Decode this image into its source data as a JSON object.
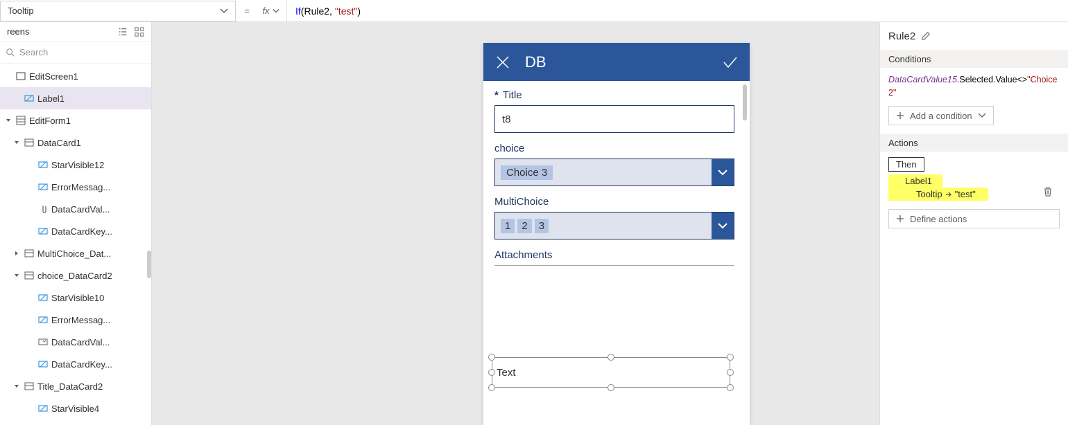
{
  "formula_bar": {
    "property": "Tooltip",
    "equals": "=",
    "fx": "fx",
    "formula_fn": "If",
    "formula_arg1": "Rule2",
    "formula_str": "\"test\""
  },
  "left_panel": {
    "header": "reens",
    "search_placeholder": "Search",
    "tree": [
      {
        "label": "EditScreen1",
        "icon": "screen",
        "indent": 0,
        "caret": ""
      },
      {
        "label": "Label1",
        "icon": "label",
        "indent": 1,
        "caret": "",
        "selected": true
      },
      {
        "label": "EditForm1",
        "icon": "form",
        "indent": 0,
        "caret": "down"
      },
      {
        "label": "DataCard1",
        "icon": "card",
        "indent": 1,
        "caret": "down"
      },
      {
        "label": "StarVisible12",
        "icon": "label",
        "indent": 2,
        "caret": ""
      },
      {
        "label": "ErrorMessag...",
        "icon": "label",
        "indent": 2,
        "caret": ""
      },
      {
        "label": "DataCardVal...",
        "icon": "attach",
        "indent": 2,
        "caret": ""
      },
      {
        "label": "DataCardKey...",
        "icon": "label",
        "indent": 2,
        "caret": ""
      },
      {
        "label": "MultiChoice_Dat...",
        "icon": "card",
        "indent": 1,
        "caret": "right"
      },
      {
        "label": "choice_DataCard2",
        "icon": "card",
        "indent": 1,
        "caret": "down"
      },
      {
        "label": "StarVisible10",
        "icon": "label",
        "indent": 2,
        "caret": ""
      },
      {
        "label": "ErrorMessag...",
        "icon": "label",
        "indent": 2,
        "caret": ""
      },
      {
        "label": "DataCardVal...",
        "icon": "dropdown",
        "indent": 2,
        "caret": ""
      },
      {
        "label": "DataCardKey...",
        "icon": "label",
        "indent": 2,
        "caret": ""
      },
      {
        "label": "Title_DataCard2",
        "icon": "card",
        "indent": 1,
        "caret": "down"
      },
      {
        "label": "StarVisible4",
        "icon": "label",
        "indent": 2,
        "caret": ""
      }
    ]
  },
  "phone": {
    "title": "DB",
    "fields": {
      "title_label": "Title",
      "title_value": "t8",
      "choice_label": "choice",
      "choice_value": "Choice 3",
      "multi_label": "MultiChoice",
      "multi_tokens": [
        "1",
        "2",
        "3"
      ],
      "attach_label": "Attachments"
    },
    "selected_label_text": "Text"
  },
  "right_panel": {
    "rule_name": "Rule2",
    "conditions_header": "Conditions",
    "cond_id": "DataCardValue15",
    "cond_prop": ".Selected.Value<>",
    "cond_str": "\"Choice 2\"",
    "add_condition": "Add a condition",
    "actions_header": "Actions",
    "then_label": "Then",
    "action_target": "Label1",
    "action_prop": "Tooltip",
    "action_val": "\"test\"",
    "define_actions": "Define actions"
  }
}
